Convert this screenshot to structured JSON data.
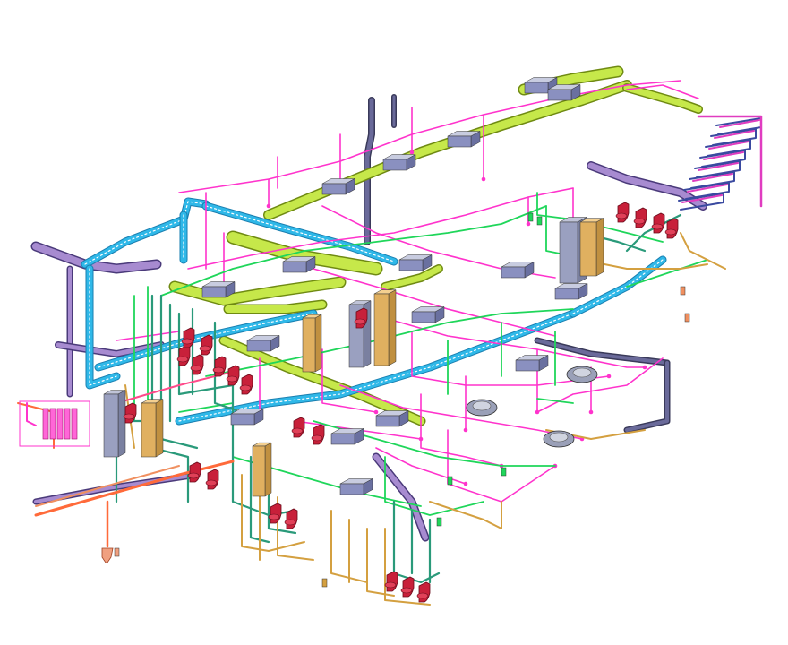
{
  "colors": {
    "background": "#ffffff",
    "supply_duct": "#c6e84a",
    "supply_duct_edge": "#6f8a12",
    "exhaust_duct": "#a78bd0",
    "exhaust_duct_edge": "#4a3a7a",
    "cable_tray": "#2fb8e8",
    "hot_water": "#ff33cc",
    "cold_water": "#1fd65a",
    "sanitary": "#2a9a7a",
    "drain": "#d4a040",
    "fire": "#ff6a3a",
    "vent_stack": "#6a6a9a",
    "fixtures": "#c8203a",
    "equipment": "#4a5aa0",
    "tanks": "#e0b060"
  },
  "icons": {
    "air_handling_unit": "ahu-icon",
    "toilet_fixture": "toilet-icon",
    "diffuser": "round-diffuser-icon",
    "water_heater": "tank-icon",
    "fan_coil": "fan-coil-icon"
  }
}
